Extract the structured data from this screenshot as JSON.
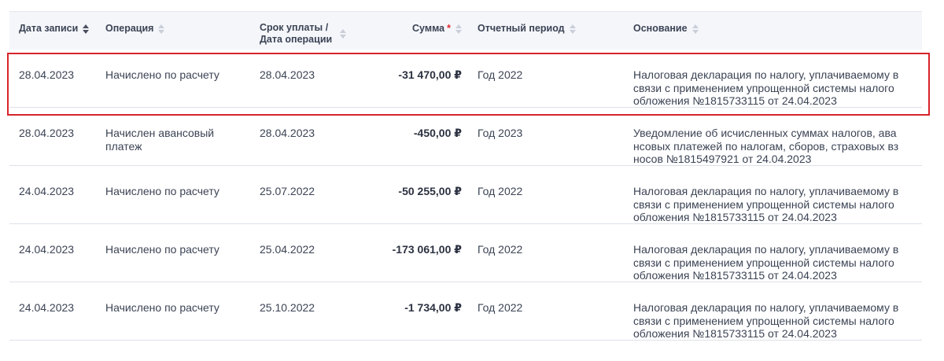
{
  "columns": {
    "date": "Дата записи",
    "operation": "Операция",
    "due_line1": "Срок уплаты /",
    "due_line2": "Дата операции",
    "amount": "Сумма",
    "amount_required": "*",
    "period": "Отчетный период",
    "basis": "Основание"
  },
  "rows": [
    {
      "date": "28.04.2023",
      "operation": "Начислено по расчету",
      "due": "28.04.2023",
      "amount": "-31 470,00 ₽",
      "period": "Год 2022",
      "basis": "Налоговая декларация по налогу, уплачиваемому в связи с применением упрощенной системы налого обложения №1815733115 от 24.04.2023",
      "highlighted": true
    },
    {
      "date": "28.04.2023",
      "operation": "Начислен авансовый платеж",
      "due": "28.04.2023",
      "amount": "-450,00 ₽",
      "period": "Год 2023",
      "basis": "Уведомление об исчисленных суммах налогов, ава нсовых платежей по налогам, сборов, страховых вз носов №1815497921 от 24.04.2023",
      "highlighted": false
    },
    {
      "date": "24.04.2023",
      "operation": "Начислено по расчету",
      "due": "25.07.2022",
      "amount": "-50 255,00 ₽",
      "period": "Год 2022",
      "basis": "Налоговая декларация по налогу, уплачиваемому в связи с применением упрощенной системы налого обложения №1815733115 от 24.04.2023",
      "highlighted": false
    },
    {
      "date": "24.04.2023",
      "operation": "Начислено по расчету",
      "due": "25.04.2022",
      "amount": "-173 061,00 ₽",
      "period": "Год 2022",
      "basis": "Налоговая декларация по налогу, уплачиваемому в связи с применением упрощенной системы налого обложения №1815733115 от 24.04.2023",
      "highlighted": false
    },
    {
      "date": "24.04.2023",
      "operation": "Начислено по расчету",
      "due": "25.10.2022",
      "amount": "-1 734,00 ₽",
      "period": "Год 2022",
      "basis": "Налоговая декларация по налогу, уплачиваемому в связи с применением упрощенной системы налого обложения №1815733115 от 24.04.2023",
      "highlighted": false
    }
  ],
  "sort": {
    "active_column": "date",
    "icon": "sort-arrows-icon"
  },
  "colors": {
    "highlight_border": "#d8232a",
    "required_mark": "#e0282e",
    "header_background": "#f4f6fa"
  }
}
